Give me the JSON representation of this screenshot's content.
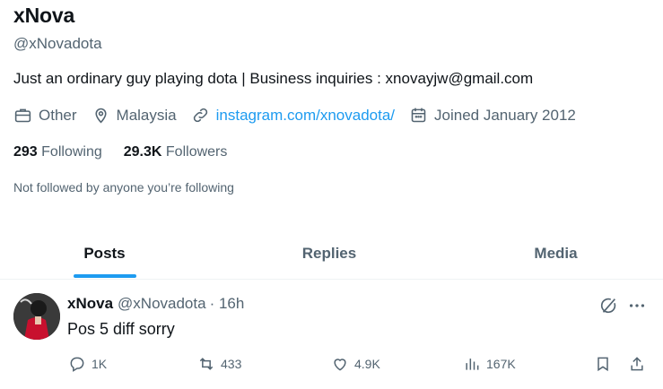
{
  "profile": {
    "name": "xNova",
    "handle": "@xNovadota",
    "bio": "Just an ordinary guy playing dota | Business inquiries : xnovayjw@gmail.com",
    "category": "Other",
    "location": "Malaysia",
    "website": "instagram.com/xnovadota/",
    "joined": "Joined January 2012",
    "following_count": "293",
    "following_label": "Following",
    "followers_count": "29.3K",
    "followers_label": "Followers",
    "not_followed_text": "Not followed by anyone you’re following"
  },
  "tabs": [
    {
      "label": "Posts",
      "active": true
    },
    {
      "label": "Replies",
      "active": false
    },
    {
      "label": "Media",
      "active": false
    }
  ],
  "post": {
    "author_name": "xNova",
    "author_handle": "@xNovadota",
    "time": "· 16h",
    "text": "Pos 5 diff sorry",
    "replies": "1K",
    "reposts": "433",
    "likes": "4.9K",
    "views": "167K"
  },
  "icons": [
    "briefcase-icon",
    "location-pin-icon",
    "link-icon",
    "calendar-icon",
    "grok-icon",
    "more-icon",
    "reply-icon",
    "repost-icon",
    "like-icon",
    "views-icon",
    "bookmark-icon",
    "share-icon"
  ],
  "colors": {
    "accent": "#1d9bf0",
    "muted": "#536471",
    "text": "#0f1419"
  }
}
